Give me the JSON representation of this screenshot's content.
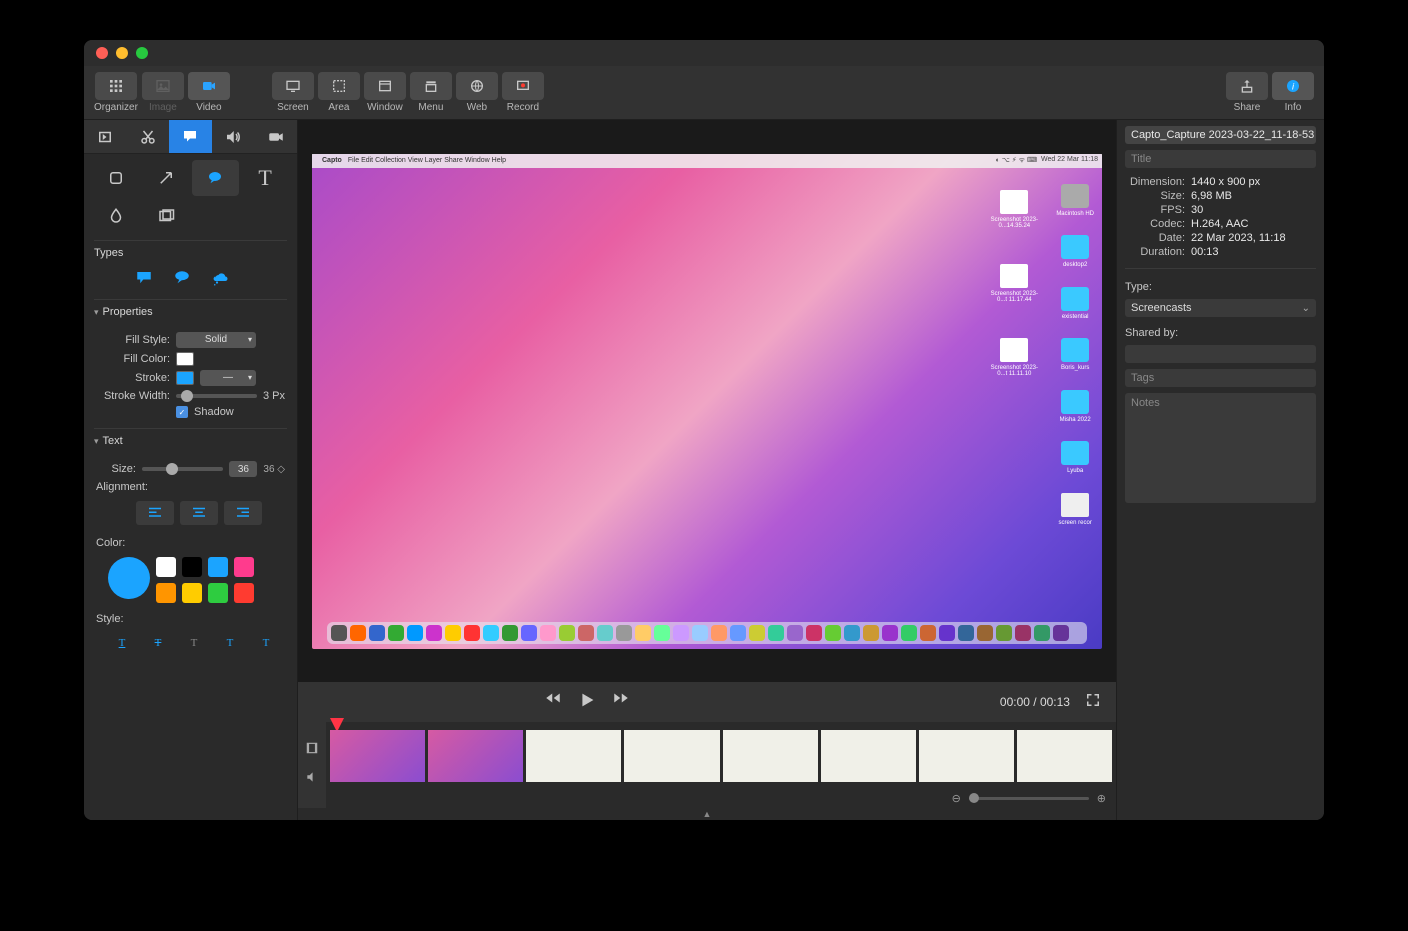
{
  "toolbar": {
    "left": [
      {
        "name": "organizer",
        "label": "Organizer"
      },
      {
        "name": "image",
        "label": "Image"
      },
      {
        "name": "video",
        "label": "Video"
      }
    ],
    "capture": [
      {
        "name": "screen",
        "label": "Screen"
      },
      {
        "name": "area",
        "label": "Area"
      },
      {
        "name": "window",
        "label": "Window"
      },
      {
        "name": "menu",
        "label": "Menu"
      },
      {
        "name": "web",
        "label": "Web"
      },
      {
        "name": "record",
        "label": "Record"
      }
    ],
    "right": [
      {
        "name": "share",
        "label": "Share"
      },
      {
        "name": "info",
        "label": "Info"
      }
    ]
  },
  "sidebar": {
    "types_label": "Types",
    "properties_label": "Properties",
    "fill_style_label": "Fill Style:",
    "fill_style_value": "Solid",
    "fill_color_label": "Fill Color:",
    "stroke_label": "Stroke:",
    "stroke_width_label": "Stroke Width:",
    "stroke_width_value": "3 Px",
    "shadow_label": "Shadow",
    "text_label": "Text",
    "size_label": "Size:",
    "size_value": "36",
    "size_step": "36 ◇",
    "alignment_label": "Alignment:",
    "color_label": "Color:",
    "style_label": "Style:"
  },
  "preview": {
    "menubar_app": "Capto",
    "menubar_items": [
      "File",
      "Edit",
      "Collection",
      "View",
      "Layer",
      "Share",
      "Window",
      "Help"
    ],
    "menubar_time": "Wed 22 Mar  11:18",
    "desktop_col1": [
      {
        "type": "img",
        "label": "Screenshot 2023-0...14.35.24"
      },
      {
        "type": "img",
        "label": "Screenshot 2023-0...t 11.17.44"
      },
      {
        "type": "img",
        "label": "Screenshot 2023-0...t 11.11.10"
      }
    ],
    "desktop_col2": [
      {
        "type": "disk",
        "label": "Macintosh HD"
      },
      {
        "type": "folder",
        "label": "desktop2"
      },
      {
        "type": "folder",
        "label": "existential"
      },
      {
        "type": "folder",
        "label": "Boris_kurs"
      },
      {
        "type": "folder",
        "label": "Misha 2022"
      },
      {
        "type": "folder",
        "label": "Lyuba"
      },
      {
        "type": "doc",
        "label": "screen recor"
      }
    ]
  },
  "playbar": {
    "time": "00:00 / 00:13"
  },
  "info": {
    "filename": "Capto_Capture 2023-03-22_11-18-53",
    "title_placeholder": "Title",
    "dimension_label": "Dimension:",
    "dimension": "1440 x 900 px",
    "size_label": "Size:",
    "size": "6,98 MB",
    "fps_label": "FPS:",
    "fps": "30",
    "codec_label": "Codec:",
    "codec": "H.264, AAC",
    "date_label": "Date:",
    "date": "22 Mar 2023, 11:18",
    "duration_label": "Duration:",
    "duration": "00:13",
    "type_label": "Type:",
    "type_value": "Screencasts",
    "shared_by_label": "Shared by:",
    "tags_placeholder": "Tags",
    "notes_placeholder": "Notes"
  },
  "colors": {
    "palette": [
      "#ffffff",
      "#000000",
      "#1ba4ff",
      "#ff3b8d",
      "#ff9500",
      "#ffcc00",
      "#2ecc40",
      "#ff3b30"
    ]
  }
}
